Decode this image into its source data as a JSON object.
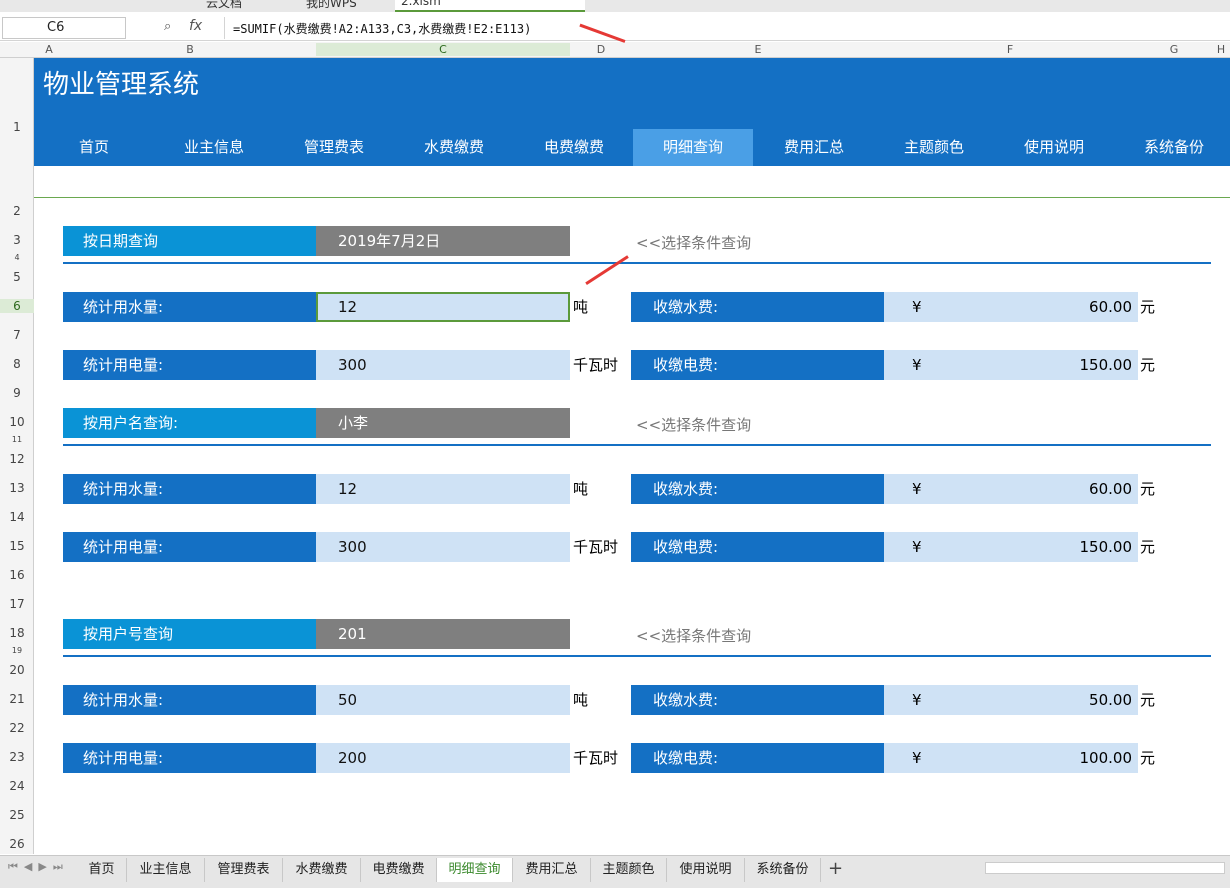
{
  "titlebar": {
    "tabs": [
      "云文档",
      "我的WPS",
      "2.xlsm"
    ]
  },
  "formula_bar": {
    "name_box": "C6",
    "fx": "fx",
    "formula": "=SUMIF(水费缴费!A2:A133,C3,水费缴费!E2:E113)"
  },
  "columns": [
    "A",
    "B",
    "C",
    "D",
    "E",
    "F",
    "G",
    "H"
  ],
  "rows": [
    "1",
    "2",
    "3",
    "4",
    "5",
    "6",
    "7",
    "8",
    "9",
    "10",
    "11",
    "12",
    "13",
    "14",
    "15",
    "16",
    "17",
    "18",
    "19",
    "20",
    "21",
    "22",
    "23",
    "24",
    "25",
    "26"
  ],
  "app": {
    "title": "物业管理系统",
    "nav": [
      "首页",
      "业主信息",
      "管理费表",
      "水费缴费",
      "电费缴费",
      "明细查询",
      "费用汇总",
      "主题颜色",
      "使用说明",
      "系统备份"
    ],
    "active_nav": "明细查询"
  },
  "hint": "<<选择条件查询",
  "sections": [
    {
      "query_label": "按日期查询",
      "query_value": "2019年7月2日",
      "water_label": "统计用水量:",
      "water_value": "12",
      "water_unit": "吨",
      "elec_label": "统计用电量:",
      "elec_value": "300",
      "elec_unit": "千瓦时",
      "water_fee_label": "收缴水费:",
      "water_fee": "60.00",
      "elec_fee_label": "收缴电费:",
      "elec_fee": "150.00",
      "currency": "¥",
      "yuan": "元"
    },
    {
      "query_label": "按用户名查询:",
      "query_value": "小李",
      "water_label": "统计用水量:",
      "water_value": "12",
      "water_unit": "吨",
      "elec_label": "统计用电量:",
      "elec_value": "300",
      "elec_unit": "千瓦时",
      "water_fee_label": "收缴水费:",
      "water_fee": "60.00",
      "elec_fee_label": "收缴电费:",
      "elec_fee": "150.00",
      "currency": "¥",
      "yuan": "元"
    },
    {
      "query_label": "按用户号查询",
      "query_value": "201",
      "water_label": "统计用水量:",
      "water_value": "50",
      "water_unit": "吨",
      "elec_label": "统计用电量:",
      "elec_value": "200",
      "elec_unit": "千瓦时",
      "water_fee_label": "收缴水费:",
      "water_fee": "50.00",
      "elec_fee_label": "收缴电费:",
      "elec_fee": "100.00",
      "currency": "¥",
      "yuan": "元"
    }
  ],
  "sheet_tabs": [
    "首页",
    "业主信息",
    "管理费表",
    "水费缴费",
    "电费缴费",
    "明细查询",
    "费用汇总",
    "主题颜色",
    "使用说明",
    "系统备份"
  ],
  "active_sheet": "明细查询",
  "colors": {
    "header_blue": "#1470c4",
    "query_blue": "#0a93d6",
    "value_bg": "#cfe2f5",
    "query_value_bg": "#7f7f7f",
    "selection": "#5b9a3b"
  }
}
